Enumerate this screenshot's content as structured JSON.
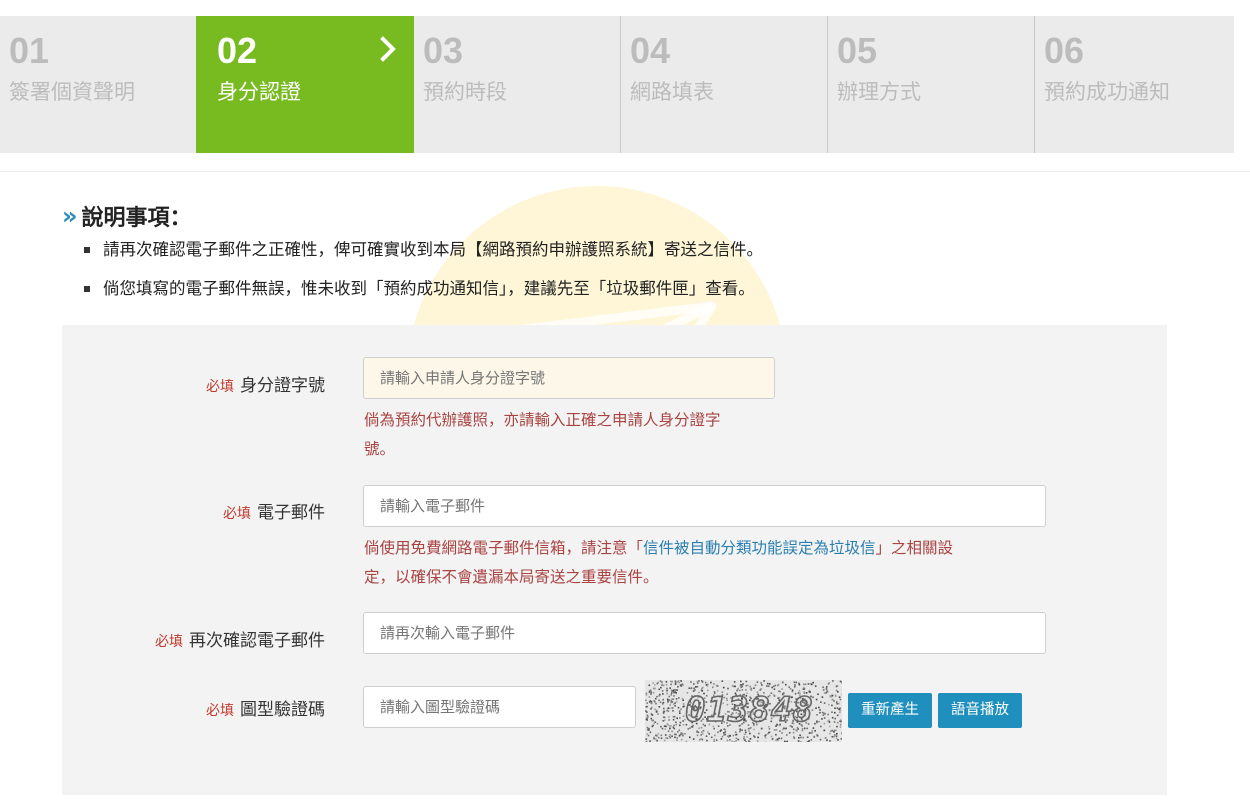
{
  "steps": [
    {
      "num": "01",
      "label": "簽署個資聲明"
    },
    {
      "num": "02",
      "label": "身分認證"
    },
    {
      "num": "03",
      "label": "預約時段"
    },
    {
      "num": "04",
      "label": "網路填表"
    },
    {
      "num": "05",
      "label": "辦理方式"
    },
    {
      "num": "06",
      "label": "預約成功通知"
    }
  ],
  "notice": {
    "title": "說明事項：",
    "items": [
      "請再次確認電子郵件之正確性，俾可確實收到本局【網路預約申辦護照系統】寄送之信件。",
      "倘您填寫的電子郵件無誤，惟未收到「預約成功通知信」，建議先至「垃圾郵件匣」查看。"
    ]
  },
  "form": {
    "required_tag": "必填",
    "id": {
      "label": "身分證字號",
      "placeholder": "請輸入申請人身分證字號",
      "hint_line1": "倘為預約代辦護照，亦請輸入正確之申請人身分證字",
      "hint_line2": "號。"
    },
    "email": {
      "label": "電子郵件",
      "placeholder": "請輸入電子郵件",
      "hint_a": "倘使用免費網路電子郵件信箱，請注意「",
      "hint_link": "信件被自動分類功能誤定為垃圾信",
      "hint_b": "」之相關設",
      "hint_line2": "定，以確保不會遺漏本局寄送之重要信件。"
    },
    "email_confirm": {
      "label": "再次確認電子郵件",
      "placeholder": "請再次輸入電子郵件"
    },
    "captcha": {
      "label": "圖型驗證碼",
      "placeholder": "請輸入圖型驗證碼",
      "image_text": "013848",
      "regenerate_label": "重新產生",
      "audio_label": "語音播放"
    }
  },
  "icons": {
    "step_arrow": "chevron-right-icon",
    "notice_marker": "double-chevron-icon",
    "watermark": "paper-plane-icon"
  },
  "colors": {
    "active_step": "#77bb21",
    "required": "#c0392b",
    "hint": "#a94442",
    "button": "#1f8fbd"
  }
}
